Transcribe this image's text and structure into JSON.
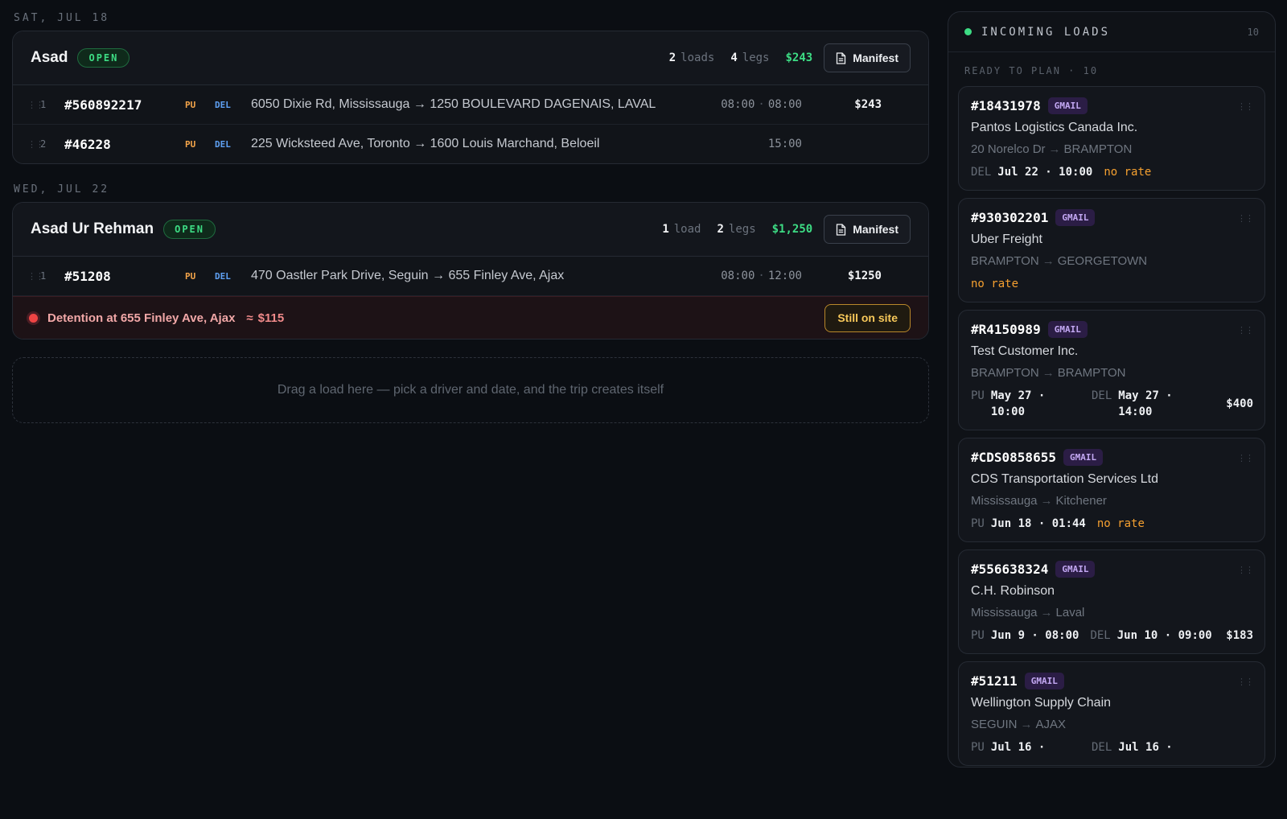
{
  "days": [
    {
      "label": "SAT, JUL 18",
      "trip": {
        "driver": "Asad",
        "status": "OPEN",
        "load_count": "2",
        "load_word": "loads",
        "leg_count": "4",
        "leg_word": "legs",
        "total": "$243",
        "manifest_label": "Manifest",
        "legs": [
          {
            "idx": "1",
            "id": "#560892217",
            "pu": "PU",
            "del": "DEL",
            "route": "6050 Dixie Rd, Mississauga → 1250 BOULEVARD DAGENAIS, LAVAL",
            "time_start": "08:00",
            "time_sep": "·",
            "time_end": "08:00",
            "amount": "$243"
          },
          {
            "idx": "2",
            "id": "#46228",
            "pu": "PU",
            "del": "DEL",
            "route": "225 Wicksteed Ave, Toronto → 1600 Louis Marchand, Beloeil",
            "time_start": "",
            "time_sep": "",
            "time_end": "15:00",
            "amount": ""
          }
        ]
      }
    },
    {
      "label": "WED, JUL 22",
      "trip": {
        "driver": "Asad Ur Rehman",
        "status": "OPEN",
        "load_count": "1",
        "load_word": "load",
        "leg_count": "2",
        "leg_word": "legs",
        "total": "$1,250",
        "manifest_label": "Manifest",
        "legs": [
          {
            "idx": "1",
            "id": "#51208",
            "pu": "PU",
            "del": "DEL",
            "route": "470 Oastler Park Drive, Seguin → 655 Finley Ave, Ajax",
            "time_start": "08:00",
            "time_sep": "·",
            "time_end": "12:00",
            "amount": "$1250"
          }
        ],
        "detention": {
          "text": "Detention at 655 Finley Ave, Ajax",
          "approx": "≈",
          "amount": "$115",
          "button": "Still on site"
        }
      }
    }
  ],
  "dropzone_text": "Drag a load here — pick a driver and date, and the trip creates itself",
  "incoming": {
    "title": "INCOMING LOADS",
    "count": "10",
    "ready_label": "READY TO PLAN · 10",
    "cards": [
      {
        "id": "#18431978",
        "source": "GMAIL",
        "customer": "Pantos Logistics Canada Inc.",
        "from": "20 Norelco Dr",
        "to": "BRAMPTON",
        "del_key": "DEL",
        "del_val": "Jul 22 · 10:00",
        "no_rate": "no rate"
      },
      {
        "id": "#930302201",
        "source": "GMAIL",
        "customer": "Uber Freight",
        "from": "BRAMPTON",
        "to": "GEORGETOWN",
        "no_rate": "no rate"
      },
      {
        "id": "#R4150989",
        "source": "GMAIL",
        "customer": "Test Customer Inc.",
        "from": "BRAMPTON",
        "to": "BRAMPTON",
        "pu_key": "PU",
        "pu_val": "May 27 · 10:00",
        "del_key": "DEL",
        "del_val": "May 27 · 14:00",
        "rate": "$400"
      },
      {
        "id": "#CDS0858655",
        "source": "GMAIL",
        "customer": "CDS Transportation Services Ltd",
        "from": "Mississauga",
        "to": "Kitchener",
        "pu_key": "PU",
        "pu_val": "Jun 18 · 01:44",
        "no_rate": "no rate"
      },
      {
        "id": "#556638324",
        "source": "GMAIL",
        "customer": "C.H. Robinson",
        "from": "Mississauga",
        "to": "Laval",
        "pu_key": "PU",
        "pu_val": "Jun 9 · 08:00",
        "del_key": "DEL",
        "del_val": "Jun 10 · 09:00",
        "rate": "$183"
      },
      {
        "id": "#51211",
        "source": "GMAIL",
        "customer": "Wellington Supply Chain",
        "from": "SEGUIN",
        "to": "AJAX",
        "pu_key": "PU",
        "pu_val": "Jul 16 ·",
        "del_key": "DEL",
        "del_val": "Jul 16 ·"
      }
    ]
  },
  "icons": {
    "doc": "document-icon",
    "grip": "drag-handle-icon",
    "arrow": "→"
  },
  "colors": {
    "accent_green": "#3ddc84",
    "pickup": "#f5a54a",
    "delivery": "#5ea0f2",
    "no_rate": "#f5a030",
    "detention": "#ef4444",
    "gmail": "#c3a8f3"
  }
}
